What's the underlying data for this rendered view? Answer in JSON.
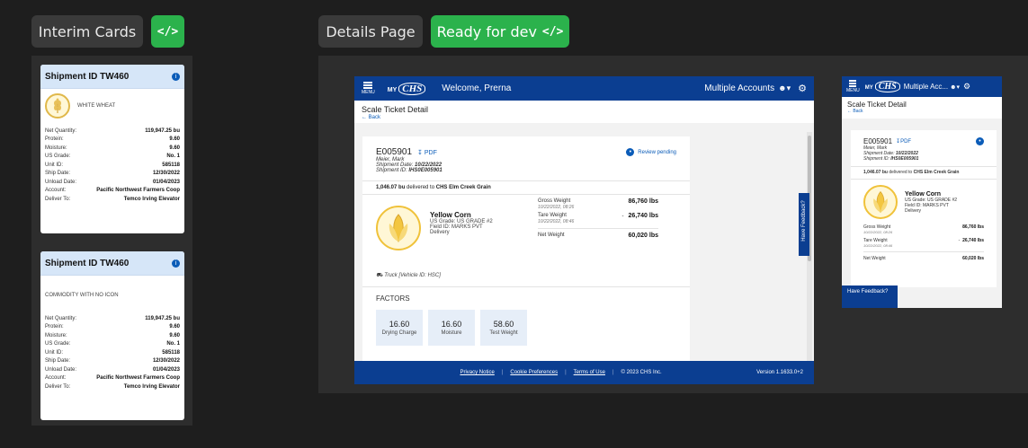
{
  "left_section": {
    "label": "Interim Cards",
    "code_icon": "</>"
  },
  "right_section": {
    "label": "Details Page",
    "status_label": "Ready for dev",
    "code_icon": "</>"
  },
  "interim_cards": [
    {
      "title": "Shipment ID TW460",
      "commodity": "WHITE WHEAT",
      "has_icon": true,
      "rows": [
        {
          "k": "Net Quantity:",
          "v": "119,947.25 bu"
        },
        {
          "k": "Protein:",
          "v": "9.60"
        },
        {
          "k": "Moisture:",
          "v": "9.60"
        },
        {
          "k": "US Grade:",
          "v": "No. 1"
        },
        {
          "k": "Unit ID:",
          "v": "585118"
        },
        {
          "k": "Ship Date:",
          "v": "12/30/2022"
        },
        {
          "k": "Unload Date:",
          "v": "01/04/2023"
        },
        {
          "k": "Account:",
          "v": "Pacific Northwest Farmers Coop"
        },
        {
          "k": "Deliver To:",
          "v": "Temco Irving Elevator"
        }
      ]
    },
    {
      "title": "Shipment ID TW460",
      "commodity": "COMMODITY WITH NO ICON",
      "has_icon": false,
      "rows": [
        {
          "k": "Net Quantity:",
          "v": "119,947.25 bu"
        },
        {
          "k": "Protein:",
          "v": "9.60"
        },
        {
          "k": "Moisture:",
          "v": "9.60"
        },
        {
          "k": "US Grade:",
          "v": "No. 1"
        },
        {
          "k": "Unit ID:",
          "v": "585118"
        },
        {
          "k": "Ship Date:",
          "v": "12/30/2022"
        },
        {
          "k": "Unload Date:",
          "v": "01/04/2023"
        },
        {
          "k": "Account:",
          "v": "Pacific Northwest Farmers Coop"
        },
        {
          "k": "Deliver To:",
          "v": "Temco Irving Elevator"
        }
      ]
    }
  ],
  "desktop": {
    "menu_label": "MENU",
    "logo_my": "MY",
    "logo_chs": "CHS",
    "welcome": "Welcome, Prerna",
    "accounts": "Multiple Accounts",
    "page_title": "Scale Ticket Detail",
    "back": "← Back",
    "ticket_id": "E005901",
    "pdf": "PDF",
    "status": "Review pending",
    "person": "Meier, Mark",
    "shipment_date_label": "Shipment Date:",
    "shipment_date": "10/22/2022",
    "shipment_id_label": "Shipment ID:",
    "shipment_id": "IHS0E005901",
    "delivered_qty": "1,046.07 bu",
    "delivered_text": "delivered to",
    "delivered_to": "CHS Elm Creek Grain",
    "commodity": "Yellow Corn",
    "grade": "US Grade: US GRADE #2",
    "field": "Field ID: MARKS PVT",
    "delivery": "Delivery",
    "gross_label": "Gross Weight",
    "gross_date": "10/22/2022, 08:26",
    "gross_value": "86,760 lbs",
    "tare_label": "Tare Weight",
    "tare_date": "10/22/2022, 08:46",
    "tare_minus": "-",
    "tare_value": "26,740 lbs",
    "net_label": "Net Weight",
    "net_value": "60,020 lbs",
    "truck": "Truck  [Vehicle ID: HSC]",
    "factors_title": "FACTORS",
    "factors": [
      {
        "value": "16.60",
        "label": "Drying Charge"
      },
      {
        "value": "16.60",
        "label": "Moisture"
      },
      {
        "value": "58.60",
        "label": "Test Weight"
      }
    ],
    "feedback": "Have Feedback?",
    "footer": {
      "privacy": "Privacy Notice",
      "cookies": "Cookie Preferences",
      "terms": "Terms of Use",
      "copyright": "© 2023 CHS Inc.",
      "version": "Version 1.1633.0+2"
    }
  },
  "mobile": {
    "menu_label": "MENU",
    "logo_my": "MY",
    "logo_chs": "CHS",
    "accounts": "Multiple Acc...",
    "page_title": "Scale Ticket Detail",
    "back": "← Back",
    "ticket_id": "E005901",
    "pdf": "PDF",
    "person": "Meier, Mark",
    "shipment_date_label": "Shipment Date:",
    "shipment_date": "10/22/2022",
    "shipment_id_label": "Shipment ID:",
    "shipment_id": "IHS0E005901",
    "delivered_qty": "1,046.07 bu",
    "delivered_text": "delivered to",
    "delivered_to": "CHS Elm Creek Grain",
    "commodity": "Yellow Corn",
    "grade": "US Grade: US GRADE #2",
    "field": "Field ID: MARKS PVT",
    "delivery": "Delivery",
    "gross_label": "Gross Weight",
    "gross_date": "10/22/2022, 08:26",
    "gross_value": "86,760 lbs",
    "tare_label": "Tare Weight",
    "tare_date": "10/22/2022, 08:46",
    "tare_minus": "-",
    "tare_value": "26,740 lbs",
    "net_label": "Net Weight",
    "net_value": "60,020 lbs",
    "feedback": "Have Feedback?"
  },
  "colors": {
    "navy": "#0b3e91",
    "accent_blue": "#0b5cb8",
    "green": "#2bb24c",
    "wheat": "#e0b84a"
  }
}
